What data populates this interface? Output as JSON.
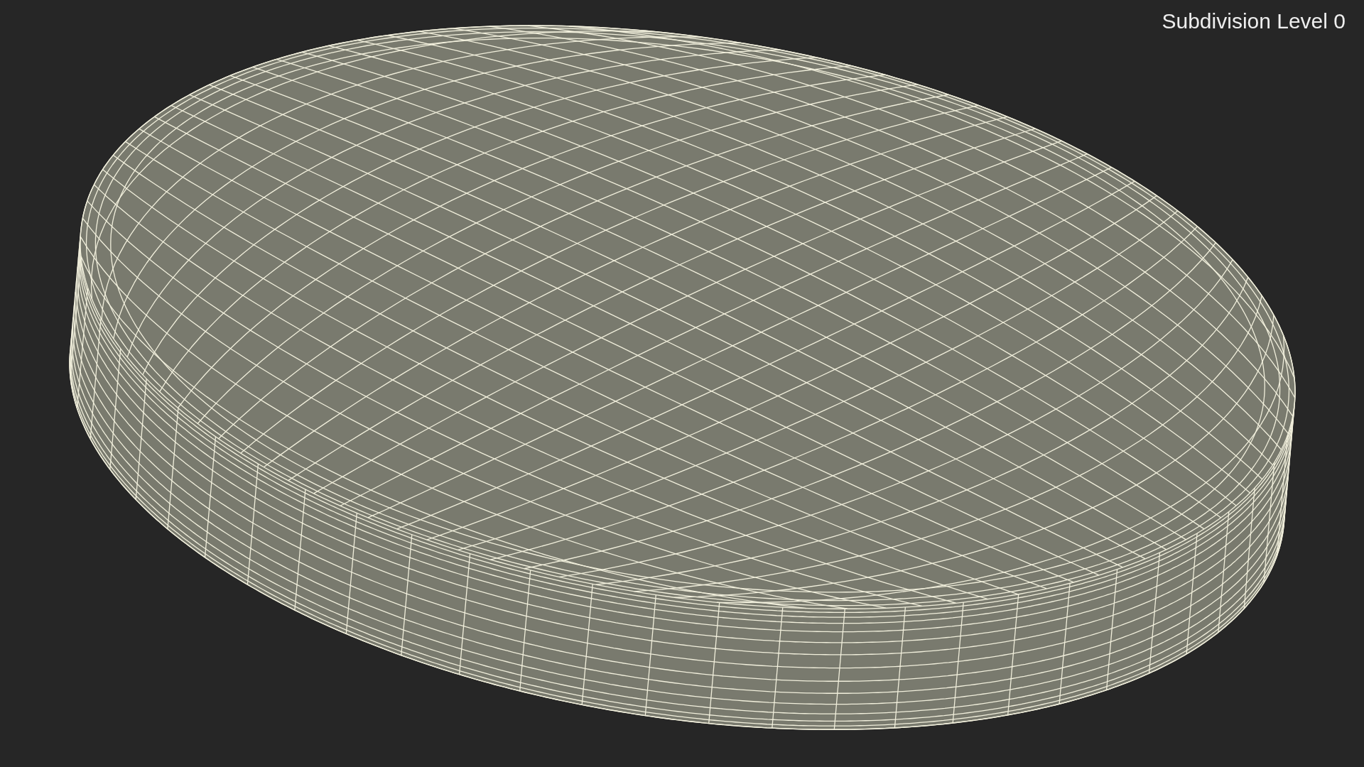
{
  "viewport": {
    "overlay_label": "Subdivision Level 0"
  }
}
